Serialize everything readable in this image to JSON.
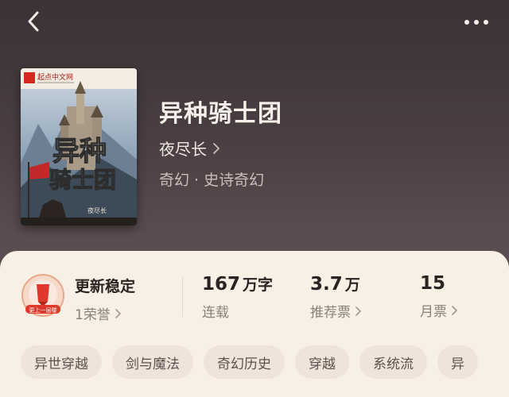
{
  "header": {
    "back_icon": "chevron-left-icon",
    "more_icon": "more-dots-icon"
  },
  "book": {
    "title": "异种骑士团",
    "author": "夜尽长",
    "genre": "奇幻 · 史诗奇幻",
    "cover": {
      "publisher": "起点中文网",
      "title_line1": "异种",
      "title_line2": "骑士团",
      "author_mark": "夜尽长"
    }
  },
  "stats": {
    "honor": {
      "label": "更新稳定",
      "count": "1荣誉",
      "badge_text": "更上一层楼"
    },
    "words": {
      "value": "167",
      "unit": "万字",
      "label": "连载"
    },
    "recommend": {
      "value": "3.7",
      "unit": "万",
      "label": "推荐票"
    },
    "monthly": {
      "value": "15",
      "label": "月票"
    }
  },
  "tags": [
    "异世穿越",
    "剑与魔法",
    "奇幻历史",
    "穿越",
    "系统流",
    "异"
  ],
  "colors": {
    "background": "#4a3e42",
    "card": "#f8efe5",
    "tag_bg": "#efe4d9",
    "badge_red": "#e0392b"
  }
}
